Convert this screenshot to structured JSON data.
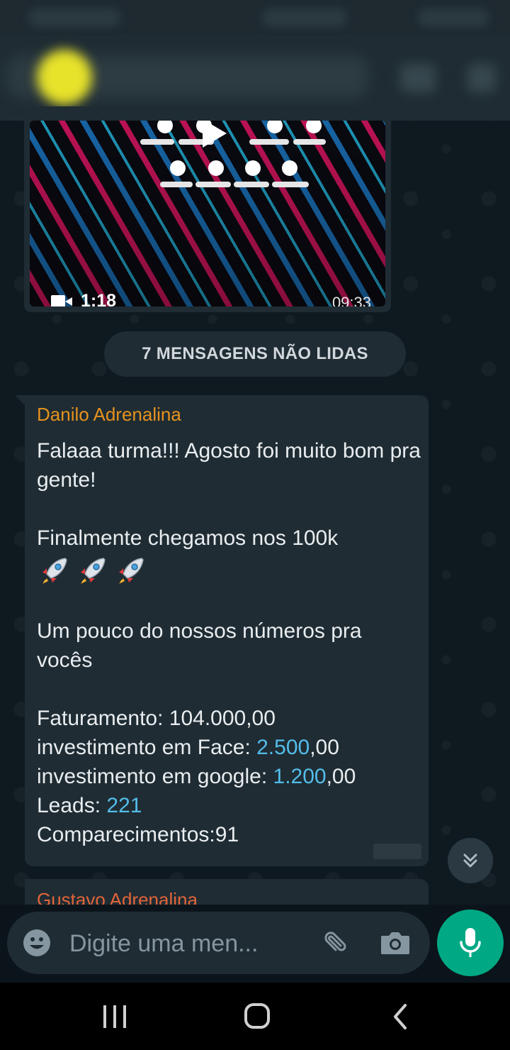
{
  "video_message": {
    "duration": "1:18",
    "time": "09:33"
  },
  "unread_banner": "7 MENSAGENS NÃO LIDAS",
  "message": {
    "sender": "Danilo Adrenalina",
    "line1": "Falaaa turma!!! Agosto foi muito bom pra gente!",
    "line2": "Finalmente chegamos nos 100k",
    "rockets": "🚀🚀🚀",
    "line3": "Um pouco do nossos números pra vocês",
    "stats": {
      "faturamento_label": "Faturamento: ",
      "faturamento_value": "104.000,00",
      "face_label": "investimento em Face: ",
      "face_link": "2.500",
      "face_suffix": ",00",
      "google_label": "investimento em google: ",
      "google_link": "1.200",
      "google_suffix": ",00",
      "leads_label": "Leads: ",
      "leads_link": "221",
      "comparecimentos": "Comparecimentos:91"
    }
  },
  "next_message": {
    "sender": "Gustavo Adrenalina"
  },
  "composer": {
    "placeholder": "Digite uma men..."
  },
  "icons": {
    "emoji": "emoji-icon",
    "attach": "paperclip-icon",
    "camera": "camera-icon",
    "mic": "mic-icon",
    "scroll_down": "double-chevron-down-icon"
  },
  "colors": {
    "sender_primary": "#e6921e",
    "sender_secondary": "#e2643a",
    "link": "#53bdeb",
    "accent": "#00a884"
  }
}
